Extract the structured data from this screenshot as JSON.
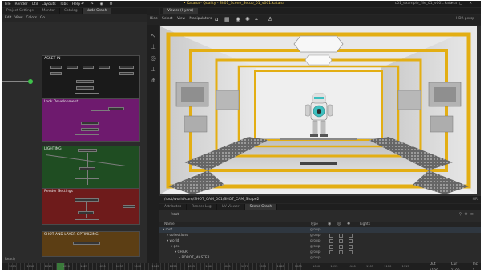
{
  "app": {
    "menus": [
      "File",
      "Render",
      "Util",
      "Layouts",
      "Tabs",
      "Help"
    ],
    "title": "• Katana - Quality - Sh01_Scene_Setup_01_v001.katana",
    "right_text": "c01_example_file_01_v001.katana"
  },
  "left_panel": {
    "tabs": [
      "Project Settings",
      "Monitor",
      "Catalog",
      "Node Graph"
    ],
    "active_tab": "Node Graph",
    "menu": [
      "Edit",
      "View",
      "Colors",
      "Go"
    ],
    "backdrops": [
      {
        "title": "ASSET IN",
        "color": "#1a1a1a"
      },
      {
        "title": "Look Development",
        "color": "#6e1a6e"
      },
      {
        "title": "LIGHTING",
        "color": "#1f4d22"
      },
      {
        "title": "Render Settings",
        "color": "#6e1b1b"
      },
      {
        "title": "SHOT AND LAYER OPTIMIZING",
        "color": "#5c3e14"
      }
    ],
    "nodes": {
      "asset_in": [
        "Alembic",
        "Alembic",
        "Alembic",
        "Alembic",
        "Alembic",
        "Merge"
      ],
      "look_dev": [
        "LookFile",
        "MaterialAssign",
        "Merge"
      ],
      "lighting": [
        "GafferThree",
        "Merge"
      ],
      "render": [
        "RenderSettings",
        "RenderOutput",
        "Merge"
      ],
      "optimizing": [
        "LOD_SelectActive"
      ]
    }
  },
  "viewer": {
    "tab": "Viewer (Hydra)",
    "menu": [
      "Hide",
      "Select",
      "View",
      "Manipulators"
    ],
    "right": "HDR  persp",
    "path": "/root/world/cam/SHOT_CAM_001/SHOT_CAM_Shape2",
    "hr": "HR",
    "icons": [
      "camera-icon",
      "grid-icon",
      "light-icon",
      "sun-icon",
      "frame-icon",
      "move-icon"
    ]
  },
  "bottom_panel": {
    "tabs": [
      "Attributes",
      "Render Log",
      "UV Viewer",
      "Scene Graph"
    ],
    "active_tab": "Scene Graph",
    "crumb": "/root",
    "columns": {
      "name": "Name",
      "type": "Type",
      "lights": "Lights"
    },
    "rows": [
      {
        "name": "root",
        "type": "group",
        "indent": 0
      },
      {
        "name": "collections",
        "type": "group",
        "indent": 1
      },
      {
        "name": "world",
        "type": "group",
        "indent": 1
      },
      {
        "name": "geo",
        "type": "group",
        "indent": 2
      },
      {
        "name": "CHAR",
        "type": "group",
        "indent": 3
      },
      {
        "name": "ROBOT_MASTER",
        "type": "group",
        "indent": 4
      }
    ]
  },
  "status": "Ready",
  "timeline": {
    "numbers": [
      "1005",
      "1010",
      "1015",
      "1020",
      "1025",
      "1030",
      "1035",
      "1040",
      "1045",
      "1050",
      "1055",
      "1060",
      "1065",
      "1070",
      "1075",
      "1080",
      "1085",
      "1090",
      "1095",
      "1100",
      "1105",
      "1110",
      "1115"
    ],
    "outputs": [
      {
        "label": "Out",
        "value": "1100"
      },
      {
        "label": "Cur",
        "value": "1100"
      },
      {
        "label": "Inc",
        "value": "1"
      }
    ]
  },
  "colors": {
    "accent_green": "#3ec24b",
    "yellow_trim": "#e3ae13",
    "robot_teal": "#3dbfbf"
  }
}
